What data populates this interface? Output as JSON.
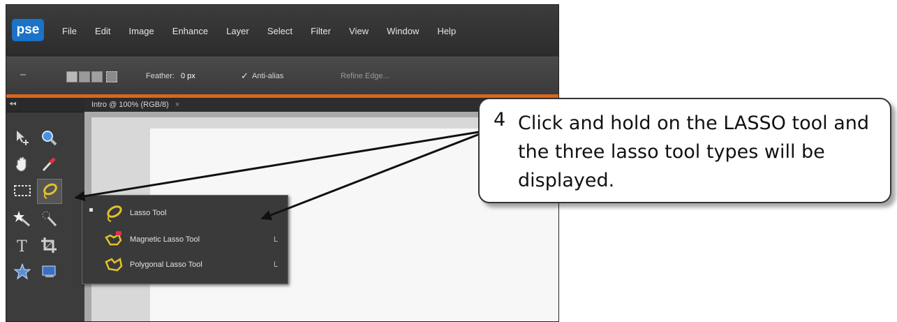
{
  "app": {
    "logo": "pse"
  },
  "menu": [
    "File",
    "Edit",
    "Image",
    "Enhance",
    "Layer",
    "Select",
    "Filter",
    "View",
    "Window",
    "Help"
  ],
  "options_bar": {
    "feather_label": "Feather:",
    "feather_value": "0 px",
    "antialias_check": "✓",
    "antialias_label": "Anti-alias",
    "refine_edge": "Refine Edge..."
  },
  "document_tab": {
    "title": "Intro @ 100% (RGB/8)",
    "close": "×"
  },
  "toolbox": {
    "collapse_glyph": "◂◂"
  },
  "lasso_flyout": [
    {
      "label": "Lasso Tool",
      "shortcut": "",
      "selected": true,
      "icon": "lasso-icon"
    },
    {
      "label": "Magnetic Lasso Tool",
      "shortcut": "L",
      "selected": false,
      "icon": "magnetic-lasso-icon"
    },
    {
      "label": "Polygonal Lasso Tool",
      "shortcut": "L",
      "selected": false,
      "icon": "polygonal-lasso-icon"
    }
  ],
  "callout": {
    "step": "4",
    "text": "Click and hold on the LASSO tool and the three lasso tool types will be displayed."
  },
  "colors": {
    "accent_orange": "#d9661f",
    "logo_blue": "#1a73c6",
    "lasso_yellow": "#e2c22a"
  }
}
